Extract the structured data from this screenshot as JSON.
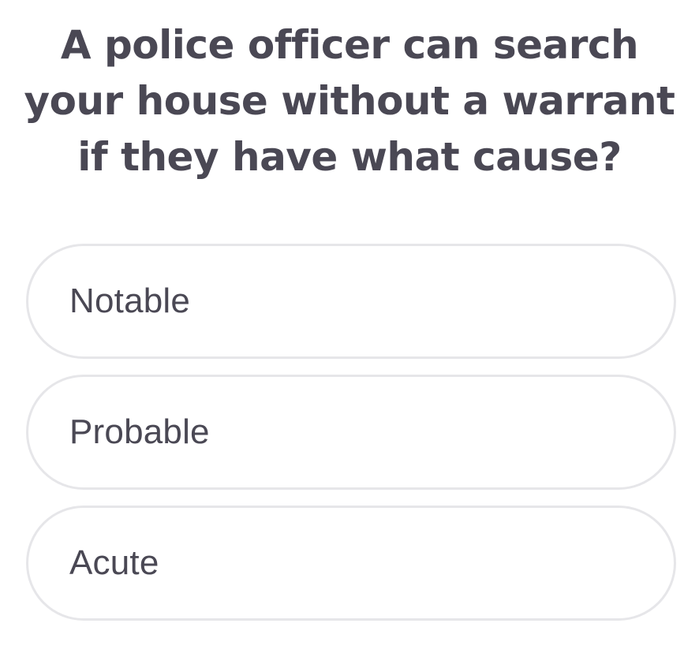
{
  "question": {
    "lines": [
      "A police officer can search",
      "your house without a warrant",
      "if they have what cause?"
    ]
  },
  "options": [
    {
      "label": "Notable"
    },
    {
      "label": "Probable"
    },
    {
      "label": "Acute"
    }
  ],
  "colors": {
    "text": "#4a4854",
    "option_border": "#e6e6e9",
    "background": "#ffffff"
  }
}
